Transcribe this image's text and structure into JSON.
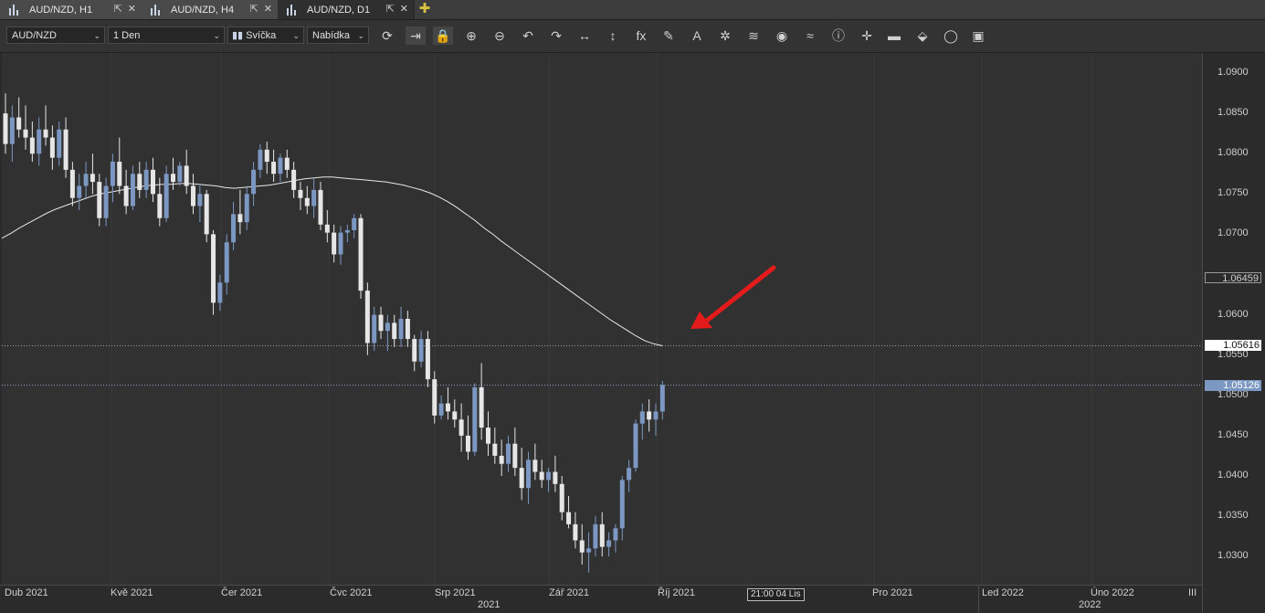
{
  "tabs": [
    {
      "label": "AUD/NZD, H1",
      "active": false
    },
    {
      "label": "AUD/NZD, H4",
      "active": false
    },
    {
      "label": "AUD/NZD, D1",
      "active": true
    }
  ],
  "toolbar": {
    "symbol": "AUD/NZD",
    "timeframe": "1 Den",
    "chart_type": "Svíčka",
    "price_side": "Nabídka",
    "icons": [
      "refresh-icon",
      "shift-chart-icon",
      "lock-icon",
      "zoom-in-icon",
      "zoom-out-icon",
      "undo-icon",
      "redo-icon",
      "fit-horizontal-icon",
      "fit-vertical-icon",
      "indicators-icon",
      "pencil-icon",
      "text-icon",
      "crosshair-tools-icon",
      "layers-icon",
      "eye-icon",
      "chart-style-icon",
      "info-icon",
      "cursor-icon",
      "color-bars-icon",
      "fill-icon",
      "settings-icon",
      "save-icon"
    ],
    "icon_glyphs": [
      "⟳",
      "⇥",
      "🔒",
      "⊕",
      "⊖",
      "↶",
      "↷",
      "↔",
      "↕",
      "fx",
      "✎",
      "A",
      "✲",
      "≋",
      "◉",
      "≈",
      "ⓘ",
      "✛",
      "▬",
      "⬙",
      "◯",
      "▣"
    ]
  },
  "price_axis": {
    "ticks": [
      "1.0900",
      "1.0850",
      "1.0800",
      "1.0750",
      "1.0700",
      "1.0600",
      "1.0550",
      "1.0500",
      "1.0450",
      "1.0400",
      "1.0350",
      "1.0300"
    ],
    "labels": {
      "outline": "1.06459",
      "white": "1.05616",
      "blue": "1.05126"
    }
  },
  "time_axis": {
    "ticks": [
      "Dub 2021",
      "Kvě 2021",
      "Čer 2021",
      "Čvc 2021",
      "Srp 2021",
      "Zář 2021",
      "Říj 2021",
      "Pro 2021",
      "Led 2022",
      "Úno 2022",
      "III"
    ],
    "years": [
      "2021",
      "2022"
    ],
    "cursor_label": "21:00 04 Lis"
  },
  "colors": {
    "bull": "#7c98c2",
    "bear": "#e6e6e6",
    "ma": "#e8e8e8",
    "arrow": "#e31b1b",
    "background": "#313131"
  },
  "chart_data": {
    "type": "candlestick",
    "symbol": "AUD/NZD",
    "timeframe": "D1",
    "ylim": [
      1.0265,
      1.0925
    ],
    "moving_average_last": 1.05616,
    "last_price": 1.05126,
    "candles": [
      [
        1.085,
        1.0875,
        1.08,
        1.0812
      ],
      [
        1.0812,
        1.086,
        1.079,
        1.0845
      ],
      [
        1.0845,
        1.087,
        1.082,
        1.083
      ],
      [
        1.083,
        1.086,
        1.0805,
        1.082
      ],
      [
        1.082,
        1.084,
        1.079,
        1.08
      ],
      [
        1.08,
        1.0845,
        1.0785,
        1.083
      ],
      [
        1.083,
        1.086,
        1.081,
        1.082
      ],
      [
        1.082,
        1.0835,
        1.078,
        1.0795
      ],
      [
        1.0795,
        1.084,
        1.0785,
        1.083
      ],
      [
        1.083,
        1.0845,
        1.077,
        1.078
      ],
      [
        1.078,
        1.079,
        1.0735,
        1.0745
      ],
      [
        1.0745,
        1.0775,
        1.073,
        1.076
      ],
      [
        1.076,
        1.079,
        1.0745,
        1.0775
      ],
      [
        1.0775,
        1.08,
        1.075,
        1.0765
      ],
      [
        1.0765,
        1.0775,
        1.071,
        1.072
      ],
      [
        1.072,
        1.077,
        1.071,
        1.076
      ],
      [
        1.076,
        1.08,
        1.074,
        1.079
      ],
      [
        1.079,
        1.082,
        1.075,
        1.076
      ],
      [
        1.076,
        1.078,
        1.0725,
        1.0735
      ],
      [
        1.0735,
        1.0785,
        1.073,
        1.0775
      ],
      [
        1.0775,
        1.079,
        1.0745,
        1.0755
      ],
      [
        1.0755,
        1.079,
        1.0745,
        1.078
      ],
      [
        1.078,
        1.0795,
        1.074,
        1.075
      ],
      [
        1.075,
        1.077,
        1.071,
        1.072
      ],
      [
        1.072,
        1.0785,
        1.0715,
        1.0775
      ],
      [
        1.0775,
        1.0795,
        1.0755,
        1.0765
      ],
      [
        1.0765,
        1.079,
        1.076,
        1.0785
      ],
      [
        1.0785,
        1.0805,
        1.075,
        1.076
      ],
      [
        1.076,
        1.0775,
        1.0725,
        1.0735
      ],
      [
        1.0735,
        1.076,
        1.0715,
        1.075
      ],
      [
        1.075,
        1.0755,
        1.069,
        1.07
      ],
      [
        1.07,
        1.0705,
        1.06,
        1.0615
      ],
      [
        1.0615,
        1.065,
        1.0605,
        1.064
      ],
      [
        1.064,
        1.07,
        1.0625,
        1.069
      ],
      [
        1.069,
        1.074,
        1.068,
        1.0725
      ],
      [
        1.0725,
        1.0755,
        1.07,
        1.0715
      ],
      [
        1.0715,
        1.076,
        1.0705,
        1.075
      ],
      [
        1.075,
        1.079,
        1.0735,
        1.078
      ],
      [
        1.078,
        1.0812,
        1.077,
        1.0805
      ],
      [
        1.0805,
        1.0815,
        1.0775,
        1.079
      ],
      [
        1.079,
        1.0805,
        1.0765,
        1.0775
      ],
      [
        1.0775,
        1.08,
        1.0765,
        1.0795
      ],
      [
        1.0795,
        1.0805,
        1.077,
        1.078
      ],
      [
        1.078,
        1.079,
        1.0745,
        1.0755
      ],
      [
        1.0755,
        1.0765,
        1.073,
        1.0745
      ],
      [
        1.0745,
        1.076,
        1.0725,
        1.0735
      ],
      [
        1.0735,
        1.077,
        1.072,
        1.0755
      ],
      [
        1.0755,
        1.0765,
        1.0705,
        1.0712
      ],
      [
        1.0712,
        1.073,
        1.069,
        1.0702
      ],
      [
        1.0702,
        1.0712,
        1.0665,
        1.0675
      ],
      [
        1.0675,
        1.071,
        1.0662,
        1.0702
      ],
      [
        1.0702,
        1.0712,
        1.069,
        1.0705
      ],
      [
        1.0705,
        1.0725,
        1.0695,
        1.072
      ],
      [
        1.072,
        1.0725,
        1.062,
        1.063
      ],
      [
        1.063,
        1.064,
        1.055,
        1.0565
      ],
      [
        1.0565,
        1.061,
        1.0555,
        1.06
      ],
      [
        1.06,
        1.061,
        1.057,
        1.058
      ],
      [
        1.058,
        1.06,
        1.0555,
        1.059
      ],
      [
        1.059,
        1.06,
        1.056,
        1.057
      ],
      [
        1.057,
        1.061,
        1.056,
        1.0595
      ],
      [
        1.0595,
        1.0605,
        1.056,
        1.057
      ],
      [
        1.057,
        1.0575,
        1.053,
        1.0542
      ],
      [
        1.0542,
        1.058,
        1.0535,
        1.057
      ],
      [
        1.057,
        1.058,
        1.051,
        1.052
      ],
      [
        1.052,
        1.053,
        1.0465,
        1.0475
      ],
      [
        1.0475,
        1.05,
        1.047,
        1.049
      ],
      [
        1.049,
        1.051,
        1.047,
        1.048
      ],
      [
        1.048,
        1.0495,
        1.046,
        1.047
      ],
      [
        1.047,
        1.049,
        1.043,
        1.045
      ],
      [
        1.045,
        1.0475,
        1.042,
        1.043
      ],
      [
        1.043,
        1.0515,
        1.0425,
        1.051
      ],
      [
        1.051,
        1.054,
        1.0445,
        1.046
      ],
      [
        1.046,
        1.048,
        1.0425,
        1.044
      ],
      [
        1.044,
        1.046,
        1.0415,
        1.0425
      ],
      [
        1.0425,
        1.0445,
        1.04,
        1.0415
      ],
      [
        1.0415,
        1.045,
        1.0405,
        1.044
      ],
      [
        1.044,
        1.046,
        1.04,
        1.041
      ],
      [
        1.041,
        1.0435,
        1.037,
        1.0385
      ],
      [
        1.0385,
        1.043,
        1.0365,
        1.042
      ],
      [
        1.042,
        1.044,
        1.0395,
        1.0405
      ],
      [
        1.0405,
        1.042,
        1.0385,
        1.0395
      ],
      [
        1.0395,
        1.041,
        1.038,
        1.0405
      ],
      [
        1.0405,
        1.0425,
        1.038,
        1.039
      ],
      [
        1.039,
        1.04,
        1.0345,
        1.0355
      ],
      [
        1.0355,
        1.0375,
        1.0335,
        1.034
      ],
      [
        1.034,
        1.0355,
        1.031,
        1.032
      ],
      [
        1.032,
        1.034,
        1.029,
        1.0305
      ],
      [
        1.0305,
        1.033,
        1.028,
        1.031
      ],
      [
        1.031,
        1.035,
        1.03,
        1.034
      ],
      [
        1.034,
        1.0355,
        1.03,
        1.0312
      ],
      [
        1.0312,
        1.033,
        1.03,
        1.032
      ],
      [
        1.032,
        1.034,
        1.0305,
        1.0335
      ],
      [
        1.0335,
        1.04,
        1.032,
        1.0395
      ],
      [
        1.0395,
        1.042,
        1.038,
        1.041
      ],
      [
        1.041,
        1.047,
        1.0405,
        1.0465
      ],
      [
        1.0465,
        1.049,
        1.0445,
        1.048
      ],
      [
        1.048,
        1.0495,
        1.0455,
        1.047
      ],
      [
        1.047,
        1.049,
        1.045,
        1.048
      ],
      [
        1.048,
        1.0518,
        1.047,
        1.0513
      ]
    ],
    "moving_average": [
      1.0695,
      1.0701,
      1.0708,
      1.0714,
      1.072,
      1.0726,
      1.0731,
      1.0735,
      1.0739,
      1.0743,
      1.0747,
      1.075,
      1.0752,
      1.0754,
      1.0756,
      1.0758,
      1.076,
      1.0761,
      1.0762,
      1.0762,
      1.0763,
      1.0763,
      1.0762,
      1.0761,
      1.076,
      1.0758,
      1.0757,
      1.0758,
      1.0759,
      1.076,
      1.0761,
      1.0763,
      1.0765,
      1.0767,
      1.0769,
      1.077,
      1.0771,
      1.0771,
      1.077,
      1.0769,
      1.0768,
      1.0767,
      1.0766,
      1.0765,
      1.0763,
      1.0761,
      1.0758,
      1.0755,
      1.0751,
      1.0746,
      1.074,
      1.0733,
      1.0725,
      1.0717,
      1.0708,
      1.07,
      1.0691,
      1.0683,
      1.0675,
      1.0667,
      1.0659,
      1.0651,
      1.0643,
      1.0635,
      1.0627,
      1.0619,
      1.0611,
      1.0603,
      1.0595,
      1.0588,
      1.0581,
      1.0574,
      1.0568,
      1.0564,
      1.05616
    ]
  }
}
